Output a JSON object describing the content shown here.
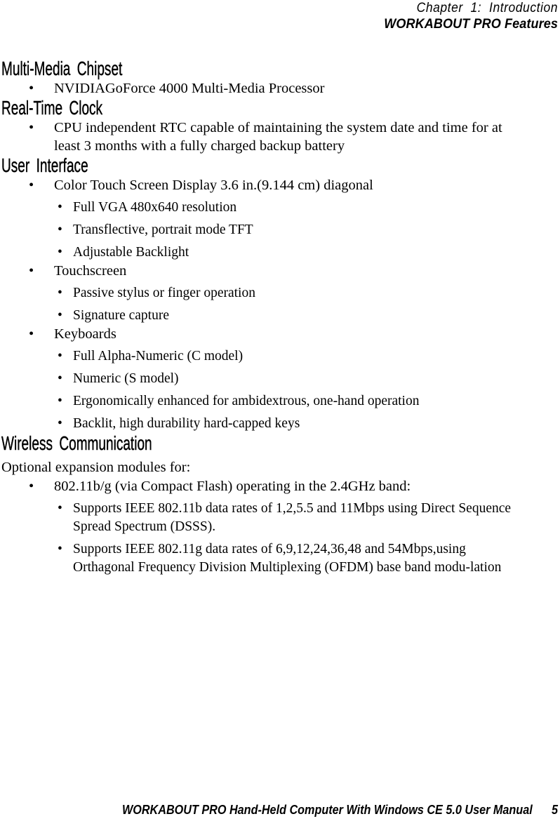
{
  "page": {
    "background_color": "#ffffff",
    "text_color": "#000000"
  },
  "header": {
    "chapter": "Chapter  1:  Introduction",
    "title": "WORKABOUT PRO Features"
  },
  "sections": [
    {
      "heading": "Multi-Media Chipset",
      "intro": null,
      "bullets": [
        {
          "text": "NVIDIAGoForce 4000 Multi-Media Processor",
          "children": []
        }
      ]
    },
    {
      "heading": "Real-Time Clock",
      "intro": null,
      "bullets": [
        {
          "text": "CPU independent RTC capable of maintaining the system date and time for at least 3 months with a fully charged backup battery",
          "children": []
        }
      ]
    },
    {
      "heading": "User Interface",
      "intro": null,
      "bullets": [
        {
          "text": "Color Touch Screen Display 3.6 in.(9.144 cm) diagonal",
          "children": [
            "Full VGA 480x640 resolution",
            "Transflective, portrait mode TFT",
            "Adjustable Backlight"
          ]
        },
        {
          "text": "Touchscreen",
          "children": [
            "Passive stylus or finger operation",
            "Signature capture"
          ]
        },
        {
          "text": "Keyboards",
          "children": [
            "Full Alpha-Numeric (C model)",
            "Numeric (S model)",
            "Ergonomically enhanced for ambidextrous, one-hand operation",
            "Backlit, high durability hard-capped keys"
          ]
        }
      ]
    },
    {
      "heading": "Wireless Communication",
      "intro": "Optional expansion modules for:",
      "bullets": [
        {
          "text": "802.11b/g (via Compact Flash) operating in the 2.4GHz band:",
          "children": [
            "Supports IEEE 802.11b data rates of 1,2,5.5 and 11Mbps using Direct Sequence Spread Spectrum (DSSS).",
            "Supports IEEE 802.11g data rates of 6,9,12,24,36,48 and 54Mbps,using Orthagonal Frequency Division Multiplexing (OFDM) base band modu-lation"
          ]
        }
      ]
    }
  ],
  "bullet_glyph": "•",
  "footer": {
    "text": "WORKABOUT PRO Hand-Held Computer With Windows CE 5.0 User Manual",
    "page_number": "5"
  }
}
